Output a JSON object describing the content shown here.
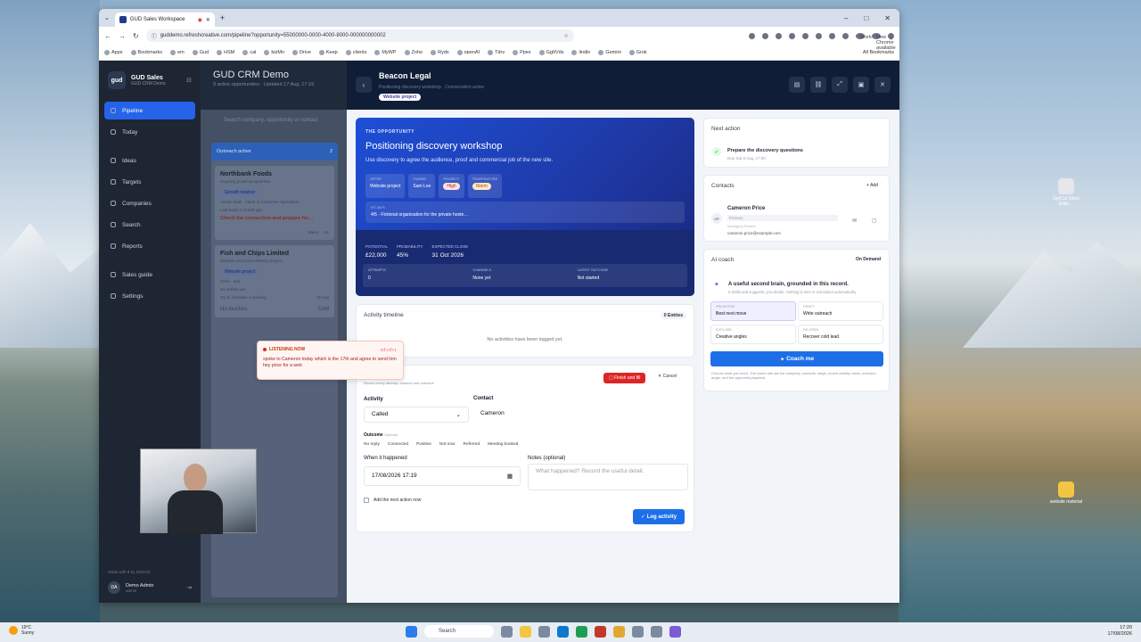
{
  "browser": {
    "tab_title": "GUD Sales Workspace",
    "url": "guddemo.refreshcreative.com/pipeline?opportunity=55000000-0000-4000-8000-000000000002",
    "profile": "Work",
    "update": "New Chrome available",
    "bookmarks": [
      "Apps",
      "Bookmarks",
      "em",
      "Gud",
      "HSM",
      "cal",
      "bizMn",
      "Drive",
      "Keep",
      "clients",
      "MyWP",
      "Zoho",
      "Ryds",
      "openAI",
      "Tdrv",
      "Ppex",
      "GgItVds",
      "lindin",
      "Gemini",
      "Grok"
    ],
    "all_bookmarks": "All Bookmarks"
  },
  "sidebar": {
    "brand": "GUD Sales",
    "brand_sub": "GUD CRM Demo",
    "logo": "gud",
    "items": [
      {
        "label": "Pipeline",
        "icon": "pipeline-icon"
      },
      {
        "label": "Today",
        "icon": "today-icon"
      },
      {
        "label": "Ideas",
        "icon": "ideas-icon"
      },
      {
        "label": "Targets",
        "icon": "targets-icon"
      },
      {
        "label": "Companies",
        "icon": "companies-icon"
      },
      {
        "label": "Search",
        "icon": "search-icon"
      },
      {
        "label": "Reports",
        "icon": "reports-icon"
      },
      {
        "label": "Sales guide",
        "icon": "guide-icon"
      },
      {
        "label": "Settings",
        "icon": "gear-icon"
      }
    ],
    "made_with": "Made with ♥ by Refresh",
    "user_initials": "DA",
    "user_name": "Demo Admin",
    "user_role": "admin"
  },
  "pipeline": {
    "title": "GUD CRM Demo",
    "subtitle": "9 active opportunities · Updated 17 Aug, 17:19",
    "search_placeholder": "Search company, opportunity or contact",
    "column": {
      "name": "Outreach active",
      "count": "2"
    },
    "cards": [
      {
        "title": "Northbank Foods",
        "sub": "Ongoing growth programme",
        "tag": "Growth retainer",
        "contact": "Aimee Shah · Head of Customer Operations",
        "last": "Last touch 1 month ago",
        "alert": "Check the connection and prepare for…",
        "owner": "Warm",
        "initials": "SL",
        "badge": "Med"
      },
      {
        "title": "Fish and Chips Limited",
        "sub": "Website and brand delivery project",
        "tag": "Website project",
        "contact": "Petra · null",
        "last": "No activity yet",
        "due": "Try to schedule a meeting",
        "date": "25 Aug",
        "touch": "No touches",
        "temp": "Cold"
      }
    ]
  },
  "detail": {
    "title": "Beacon Legal",
    "subtitle": "Positioning discovery workshop · Conversation active",
    "badge": "Website project",
    "hero": {
      "eyebrow": "THE OPPORTUNITY",
      "headline": "Positioning discovery workshop",
      "desc": "Use discovery to agree the audience, proof and commercial job of the new site.",
      "chips": [
        {
          "label": "OFFER",
          "value": "Website project"
        },
        {
          "label": "OWNER",
          "value": "Sam Lee"
        },
        {
          "label": "PRIORITY",
          "value": "High"
        },
        {
          "label": "TEMPERATURE",
          "value": "Warm"
        }
      ],
      "fit_label": "FIT",
      "fit_score": "4/5",
      "fit_text": "4/5 · Fictional organisation for the private hoste…",
      "stats": [
        {
          "label": "POTENTIAL",
          "value": "£22,000"
        },
        {
          "label": "PROBABILITY",
          "value": "45%"
        },
        {
          "label": "EXPECTED CLOSE",
          "value": "31 Oct 2026"
        }
      ],
      "stats2": [
        {
          "label": "ATTEMPTS",
          "value": "0"
        },
        {
          "label": "CHANNELS",
          "value": "None yet"
        },
        {
          "label": "LATEST OUTCOME",
          "value": "Not started"
        }
      ]
    },
    "timeline": {
      "title": "Activity timeline",
      "count": "0 Entries",
      "empty": "No activities have been logged yet."
    },
    "log": {
      "title": "Log an activity",
      "sub": "Record every attempt, channel and outcome",
      "finish": "Finish and fill",
      "cancel": "Cancel",
      "activity_label": "Activity",
      "activity_value": "Called",
      "contact_label": "Contact",
      "contact_value": "Cameron",
      "outcome_label": "Outcome",
      "outcome_opt": "Optional",
      "outcomes": [
        "No reply",
        "Connected",
        "Positive",
        "Not now",
        "Referred",
        "Meeting booked"
      ],
      "when_label": "When it happened",
      "when_value": "17/08/2026 17:19",
      "notes_label": "Notes (optional)",
      "notes_placeholder": "What happened? Record the useful detail.",
      "add_next": "Add the next action now",
      "submit": "Log activity"
    },
    "listening": {
      "title": "LISTENING NOW",
      "wave": "ıılıılıı",
      "text": "spoke to Cameron today which is the 17th and agree to send him hey price for a web"
    },
    "next_action": {
      "title": "Next action",
      "task": "Prepare the discovery questions",
      "due": "Due Sat 8 Aug, 17:00"
    },
    "contacts": {
      "title": "Contacts",
      "add": "Add",
      "initials": "CP",
      "name": "Cameron Price",
      "primary": "Primary",
      "role": "Managing Partner",
      "email": "cameron.price@example.com"
    },
    "coach": {
      "title": "AI coach",
      "mode": "On Demand",
      "headline": "A useful second brain, grounded in this record.",
      "desc": "It drafts and suggests; you decide. Nothing is sent or scheduled automatically.",
      "options": [
        {
          "label": "PRIORITISE",
          "value": "Best next move"
        },
        {
          "label": "DRAFT",
          "value": "Write outreach"
        },
        {
          "label": "EXPLORE",
          "value": "Creative angles"
        },
        {
          "label": "RE-OPEN",
          "value": "Recover cold lead"
        }
      ],
      "button": "Coach me",
      "footer": "Choose what you need. The coach will use the company, contacts, stage, recent activity, tasks, outreach angle, and the approved playbook."
    }
  },
  "desktop": {
    "icons": [
      {
        "label": "GptCut Video Edito…"
      },
      {
        "label": "website material"
      }
    ]
  },
  "taskbar": {
    "temp": "19°C",
    "weather": "Sunny",
    "search": "Search",
    "time": "17:20",
    "date": "17/08/2026"
  }
}
